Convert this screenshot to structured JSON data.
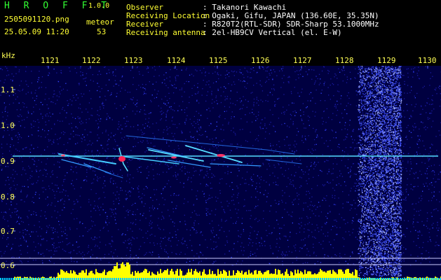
{
  "header": {
    "app_name": "H R O F F T",
    "version": "1.0.0",
    "filename": "2505091120.png",
    "timestamp": "25.05.09 11:20",
    "event_type": "meteor",
    "event_count": "53",
    "info": [
      {
        "key": "Observer",
        "value": ": Takanori Kawachi"
      },
      {
        "key": "Receiving Location",
        "value": ": Ogaki, Gifu, JAPAN (136.60E, 35.35N)"
      },
      {
        "key": "Receiver",
        "value": ": R820T2(RTL-SDR) SDR-Sharp 53.1000MHz"
      },
      {
        "key": "Receiving antenna",
        "value": ": 2el-HB9CV Vertical (el. E-W)"
      }
    ]
  },
  "time_axis": {
    "labels": [
      "1121",
      "1122",
      "1123",
      "1124",
      "1125",
      "1126",
      "1127",
      "1128",
      "1129",
      "1130"
    ]
  },
  "freq_axis": {
    "unit": "kHz",
    "labels": [
      "1.1",
      "1.0",
      "0.9",
      "0.8",
      "0.7",
      "0.6"
    ]
  },
  "colors": {
    "background": "#000033",
    "signal": "#33ddff",
    "peak": "#ff2255",
    "level_bar": "#ffff00",
    "floor_bar": "#00ccff"
  }
}
